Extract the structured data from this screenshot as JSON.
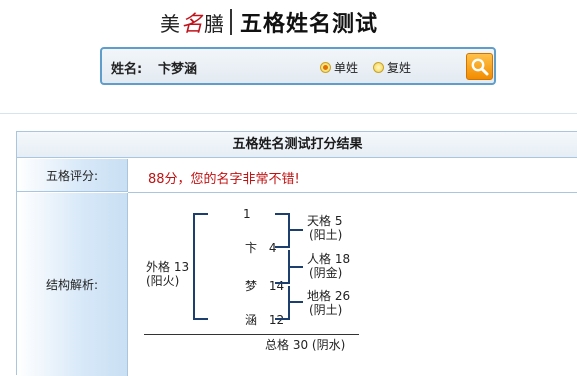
{
  "header": {
    "brand_left": "美",
    "brand_mark": "名",
    "brand_right": "膳",
    "title": "五格姓名测试"
  },
  "search": {
    "label": "姓名:",
    "value": "卞梦涵",
    "options": [
      {
        "label": "单姓",
        "selected": true
      },
      {
        "label": "复姓",
        "selected": false
      }
    ],
    "button_icon": "magnifier-icon"
  },
  "result": {
    "title": "五格姓名测试打分结果",
    "score_label": "五格评分:",
    "score_text": "88分，您的名字非常不错!",
    "structure_label": "结构解析:",
    "structure": {
      "chars": [
        {
          "char": "",
          "stroke": "1"
        },
        {
          "char": "卞",
          "stroke": "4"
        },
        {
          "char": "梦",
          "stroke": "14"
        },
        {
          "char": "涵",
          "stroke": "12"
        }
      ],
      "outer": {
        "name": "外格 13",
        "element": "(阳火)"
      },
      "heaven": {
        "name": "天格 5",
        "element": "(阳土)"
      },
      "person": {
        "name": "人格 18",
        "element": "(阴金)"
      },
      "earth": {
        "name": "地格 26",
        "element": "(阴土)"
      },
      "total": "总格 30 (阴水)"
    }
  },
  "colors": {
    "accent_border": "#5f9ecb",
    "score_red": "#c21111",
    "label_bg": "#c9dff3",
    "search_button": "#f28c00"
  }
}
